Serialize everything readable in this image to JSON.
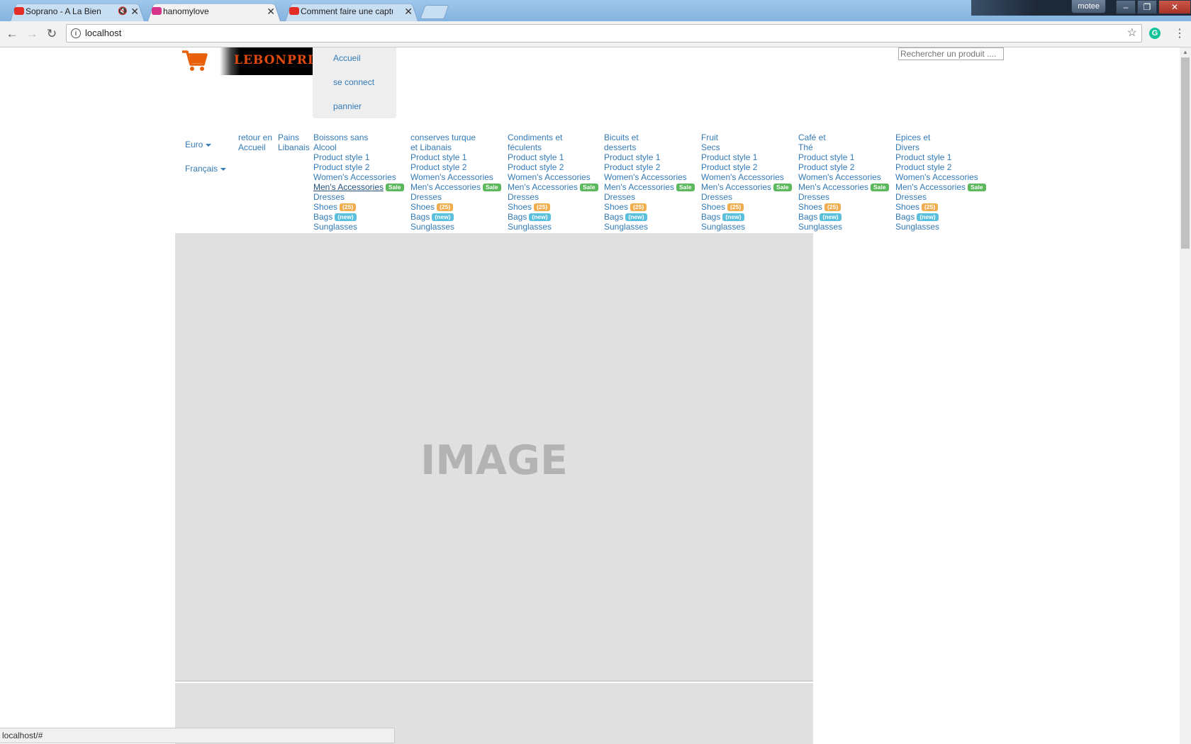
{
  "browser": {
    "tabs": [
      {
        "title": "Soprano - A La Bien",
        "favicon": "youtube-icon",
        "muted": true
      },
      {
        "title": "hanomylove",
        "favicon": "site-icon",
        "active": true
      },
      {
        "title": "Comment faire une captu",
        "favicon": "youtube-icon"
      }
    ],
    "user": "motee",
    "url": "localhost",
    "status_url": "localhost/#"
  },
  "site": {
    "logo_text": "LEBONPRIX",
    "menu": [
      "Accueil",
      "se connect",
      "pannier"
    ],
    "search_placeholder": "Rechercher un produit ....",
    "currency": "Euro",
    "language": "Français",
    "nav": [
      {
        "lines": [
          "retour en",
          "Accueil"
        ]
      },
      {
        "lines": [
          "Pains",
          "Libanais"
        ]
      }
    ],
    "categories": [
      {
        "title": [
          "Boissons sans",
          "Alcool"
        ]
      },
      {
        "title": [
          "conserves turque",
          "et Libanais"
        ]
      },
      {
        "title": [
          "Condiments et",
          "féculents"
        ]
      },
      {
        "title": [
          "Bicuits et",
          "desserts"
        ]
      },
      {
        "title": [
          "Fruit",
          "Secs"
        ]
      },
      {
        "title": [
          "Café et",
          "Thé"
        ]
      },
      {
        "title": [
          "Epices et",
          "Divers"
        ]
      }
    ],
    "subitems": {
      "p1": "Product style 1",
      "p2": "Product style 2",
      "women": "Women's Accessories",
      "men": "Men's Accessories",
      "sale_badge": "Sale",
      "dresses": "Dresses",
      "shoes": "Shoes",
      "shoes_count": "(25)",
      "bags": "Bags",
      "bags_badge": "(new)",
      "sunglasses": "Sunglasses"
    },
    "placeholder_label": "IMAGE"
  },
  "colors": {
    "link": "#337ab7",
    "sale": "#5cb85c",
    "count": "#f0ad4e",
    "new": "#5bc0de",
    "logo_text": "#e34b0e",
    "cart": "#e8600a"
  }
}
